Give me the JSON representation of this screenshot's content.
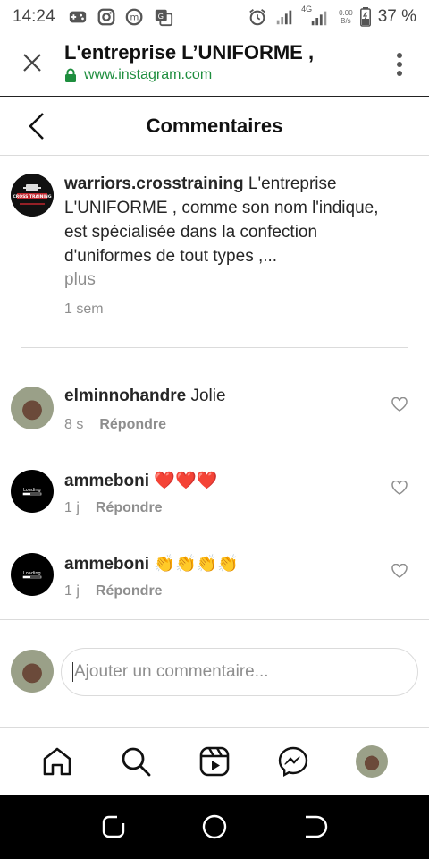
{
  "status_bar": {
    "time": "14:24",
    "network": "4G",
    "speed_top": "0.00",
    "speed_unit": "B/s",
    "battery": "37 %"
  },
  "browser": {
    "title": "L'entreprise L’UNIFORME ,",
    "url": "www.instagram.com"
  },
  "page": {
    "title": "Commentaires"
  },
  "caption": {
    "username": "warriors.crosstraining",
    "text": " L'entreprise L'UNIFORME , comme son nom l'indique, est spécialisée dans la confection d'uniformes de tout types ,...",
    "more": "plus",
    "time": "1 sem",
    "avatar_text": "CROSS TRAINING"
  },
  "comments": [
    {
      "username": "elminnohandre",
      "text": " Jolie",
      "time": "8 s",
      "reply": "Répondre"
    },
    {
      "username": "ammeboni",
      "text": " ❤️❤️❤️",
      "time": "1 j",
      "reply": "Répondre",
      "avatar_text": "Loading"
    },
    {
      "username": "ammeboni",
      "text": " 👏👏👏👏",
      "time": "1 j",
      "reply": "Répondre",
      "avatar_text": "Loading"
    }
  ],
  "add_comment": {
    "placeholder": "Ajouter un commentaire..."
  },
  "bottom_nav": [
    "home-icon",
    "search-icon",
    "reels-icon",
    "messenger-icon",
    "profile-avatar"
  ],
  "colors": {
    "url_green": "#1e8e3e",
    "muted": "#8e8e8e",
    "text": "#262626",
    "divider": "#dbdbdb"
  }
}
